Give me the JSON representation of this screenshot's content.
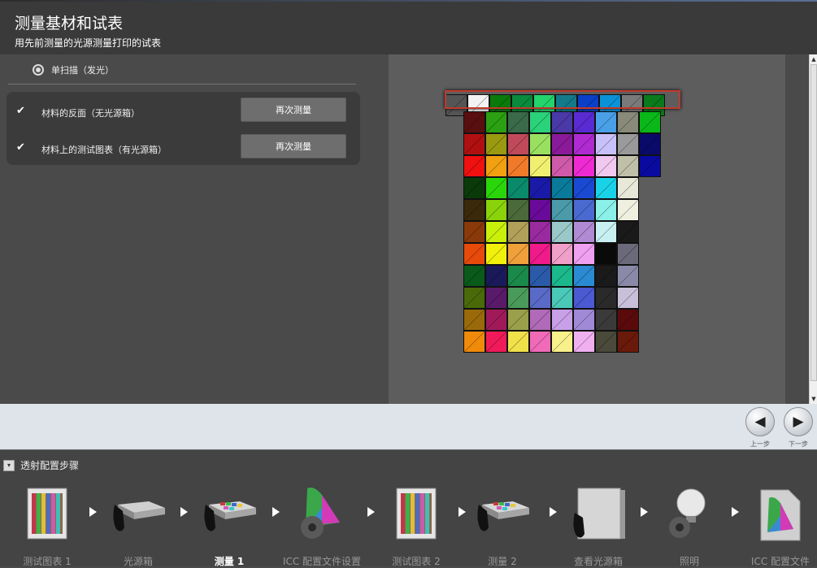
{
  "header": {
    "title": "测量基材和试表",
    "subtitle": "用先前测量的光源测量打印的试表"
  },
  "scan_mode": {
    "label": "单扫描（发光）",
    "selected": true
  },
  "measurements": [
    {
      "label": "材料的反面（无光源箱）",
      "button": "再次测量",
      "done": true
    },
    {
      "label": "材料上的测试图表（有光源箱）",
      "button": "再次测量",
      "done": true
    }
  ],
  "nav": {
    "prev_label": "上一步",
    "next_label": "下一步",
    "prev_icon": "◀",
    "next_icon": "▶"
  },
  "workflow": {
    "title": "透射配置步骤",
    "toggle_icon": "▾",
    "steps": [
      {
        "label": "测试图表 1",
        "icon": "test-chart-icon",
        "active": false
      },
      {
        "label": "光源箱",
        "icon": "lightbox-icon",
        "active": false
      },
      {
        "label": "测量 1",
        "icon": "measure-device-icon",
        "active": true
      },
      {
        "label": "ICC 配置文件设置",
        "icon": "icc-settings-icon",
        "active": false
      },
      {
        "label": "测试图表 2",
        "icon": "test-chart-icon",
        "active": false
      },
      {
        "label": "测量 2",
        "icon": "measure-device-icon",
        "active": false
      },
      {
        "label": "查看光源箱",
        "icon": "view-lightbox-icon",
        "active": false
      },
      {
        "label": "照明",
        "icon": "lighting-icon",
        "active": false
      },
      {
        "label": "ICC 配置文件",
        "icon": "icc-profile-icon",
        "active": false
      }
    ]
  },
  "test_chart": {
    "header_row": [
      "#555555",
      "#f2f2f2",
      "#0a7a0a",
      "#0a8a3c",
      "#22d46a",
      "#137a8a",
      "#0a3fc8",
      "#0a92d6",
      "#7a7a7a",
      "#0a7a1a"
    ],
    "rows": [
      [
        "#5a0f0f",
        "#2aa012",
        "#3a6a4a",
        "#2ad27a",
        "#4a3aa8",
        "#5a2ad2",
        "#4aa0e8",
        "#8a8a7a",
        "#0ab81a"
      ],
      [
        "#b01010",
        "#9a9a10",
        "#c04a5a",
        "#9ae060",
        "#8a1a9a",
        "#b02ad2",
        "#c8c0f8",
        "#9a9a9a",
        "#0a0a6a"
      ],
      [
        "#f01010",
        "#f0a010",
        "#f07a2a",
        "#f0f070",
        "#d05aaa",
        "#f02ad2",
        "#f0c8f0",
        "#c0c0a8",
        "#0a0aa0"
      ],
      [
        "#0a3a0a",
        "#2ad60a",
        "#0a8a6a",
        "#1a1aa8",
        "#0a7a9a",
        "#1a4ad2",
        "#1ad2e8",
        "#e8e8d8",
        null
      ],
      [
        "#3a2a0a",
        "#8ad20a",
        "#4a6a3a",
        "#6a0a9a",
        "#4a9aaa",
        "#4a6ad2",
        "#8af0e8",
        "#f0f0e0",
        null
      ],
      [
        "#8a3a0a",
        "#c8f00a",
        "#b0a05a",
        "#9a2aa0",
        "#9ac8c8",
        "#b08ad2",
        "#c8f0f0",
        "#1a1a1a",
        null
      ],
      [
        "#e84a0a",
        "#f0f00a",
        "#f0a03a",
        "#f01a8a",
        "#f0a0c8",
        "#f0a0f0",
        "#0a0a0a",
        "#6a6a7a",
        null
      ],
      [
        "#0a5a1a",
        "#1a1a5a",
        "#1a8a4a",
        "#2a5aa8",
        "#1ab88a",
        "#2a8ad2",
        "#1a1a1a",
        "#8a8aa8",
        null
      ],
      [
        "#4a6a0a",
        "#5a1a6a",
        "#4a9a5a",
        "#5a6ac8",
        "#4ac8b8",
        "#4a5ad2",
        "#2a2a2a",
        "#c8c0d8",
        null
      ],
      [
        "#9a6a0a",
        "#a01a5a",
        "#9aa04a",
        "#b06ab8",
        "#c8a0e8",
        "#a08ad8",
        "#3a3a3a",
        "#5a0a0a",
        null
      ],
      [
        "#f08a0a",
        "#f01a5a",
        "#f0e04a",
        "#f06ab8",
        "#f8f08a",
        "#f0b0f0",
        "#4a4a3a",
        "#6a1a0a",
        null
      ]
    ]
  }
}
